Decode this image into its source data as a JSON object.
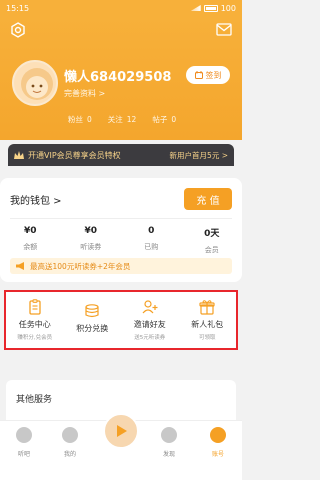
{
  "status_bar": {
    "time": "15:15",
    "battery": "100"
  },
  "user": {
    "name": "懒人684029508",
    "profile_link": "完善资料 >",
    "checkin_label": "签到",
    "stats": [
      {
        "label": "粉丝",
        "value": "0"
      },
      {
        "label": "关注",
        "value": "12"
      },
      {
        "label": "帖子",
        "value": "0"
      }
    ]
  },
  "vip": {
    "text": "开通VIP会员尊享会员特权",
    "promo": "新用户首月5元 >"
  },
  "wallet": {
    "title": "我的钱包 >",
    "recharge_label": "充 值",
    "items": [
      {
        "value": "¥0",
        "label": "余额"
      },
      {
        "value": "¥0",
        "label": "听读券"
      },
      {
        "value": "0",
        "label": "已购"
      },
      {
        "value": "0天",
        "label": "会员"
      }
    ],
    "promo_text": "最高送100元听读券+2年会员"
  },
  "tasks": [
    {
      "icon": "clipboard-icon",
      "label": "任务中心",
      "sub": "赚积分,兑会员"
    },
    {
      "icon": "coin-exchange-icon",
      "label": "积分兑换",
      "sub": ""
    },
    {
      "icon": "invite-icon",
      "label": "邀请好友",
      "sub": "送5元听读券"
    },
    {
      "icon": "gift-icon",
      "label": "新人礼包",
      "sub": "可领取"
    }
  ],
  "other_services": {
    "title": "其他服务"
  },
  "bottom_nav": [
    {
      "label": "听吧"
    },
    {
      "label": "我的"
    },
    {
      "label": "发现"
    },
    {
      "label": "账号"
    }
  ],
  "colors": {
    "accent": "#f5a024",
    "highlight": "#e8262c",
    "vip_bg": "#3c3b3f"
  }
}
